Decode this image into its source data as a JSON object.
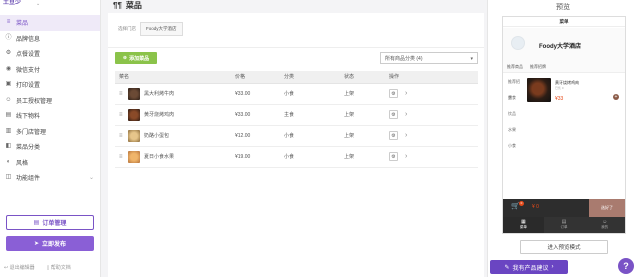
{
  "app": {
    "logo_text": "土豆少",
    "logo_chevron": "⌄"
  },
  "sidebar": {
    "items": [
      {
        "label": "菜品",
        "icon": "list-icon",
        "glyph": "≡",
        "active": true
      },
      {
        "label": "品牌信息",
        "icon": "info-icon",
        "glyph": "ⓘ"
      },
      {
        "label": "点餐设置",
        "icon": "settings-icon",
        "glyph": "⚙"
      },
      {
        "label": "微信支付",
        "icon": "wechat-pay-icon",
        "glyph": "◉"
      },
      {
        "label": "打印设置",
        "icon": "printer-icon",
        "glyph": "▣"
      },
      {
        "label": "员工授权管理",
        "icon": "staff-icon",
        "glyph": "☺"
      },
      {
        "label": "线下物料",
        "icon": "material-icon",
        "glyph": "▤"
      },
      {
        "label": "多门店管理",
        "icon": "stores-icon",
        "glyph": "▥"
      },
      {
        "label": "菜品分类",
        "icon": "category-icon",
        "glyph": "◧"
      },
      {
        "label": "风格",
        "icon": "style-icon",
        "glyph": "◐"
      },
      {
        "label": "功能组件",
        "icon": "components-icon",
        "glyph": "◫",
        "chevron": "⌄"
      }
    ],
    "order_mgmt_label": "订单管理",
    "publish_label": "立即发布",
    "exit_edit_label": "退出编辑器",
    "help_doc_label": "帮助文档"
  },
  "main": {
    "title": "菜品",
    "store_label": "选择门店",
    "store_value": "Foody大学酒店",
    "add_button": "添加菜品",
    "category_select": "所有商品分类 (4)",
    "table": {
      "headers": [
        "菜名",
        "价格",
        "分类",
        "状态",
        "操作"
      ],
      "rows": [
        {
          "name": "黑大利烤牛肉",
          "price": "¥33.00",
          "category": "小食",
          "status": "上架",
          "thumb": "#3d2a20"
        },
        {
          "name": "黄牙烧烤鸡肉",
          "price": "¥33.00",
          "category": "主食",
          "status": "上架",
          "thumb": "#5a3a28"
        },
        {
          "name": "奶酪小蛋包",
          "price": "¥12.00",
          "category": "小食",
          "status": "上架",
          "thumb": "#c9a16a"
        },
        {
          "name": "夏日小食水果",
          "price": "¥19.00",
          "category": "小食",
          "status": "上架",
          "thumb": "#d9a36a"
        }
      ]
    }
  },
  "preview": {
    "title": "预览",
    "phone_header": "菜单",
    "store_name": "Foody大学酒店",
    "nav": [
      "推荐商品",
      "推荐招牌"
    ],
    "categories": [
      "推荐招牌",
      "主食",
      "饮品",
      "水果",
      "小食"
    ],
    "item": {
      "name": "黄牙烧烤鸡肉",
      "sold": "已售 0",
      "price": "¥33"
    },
    "cart_count": "0",
    "cart_price": "¥ 0",
    "checkout": "选好了",
    "tabs": [
      "菜单",
      "订单",
      "我的"
    ],
    "preview_mode_button": "进入预览模式"
  },
  "feedback_button": "我有产品建议",
  "help_button": "?"
}
